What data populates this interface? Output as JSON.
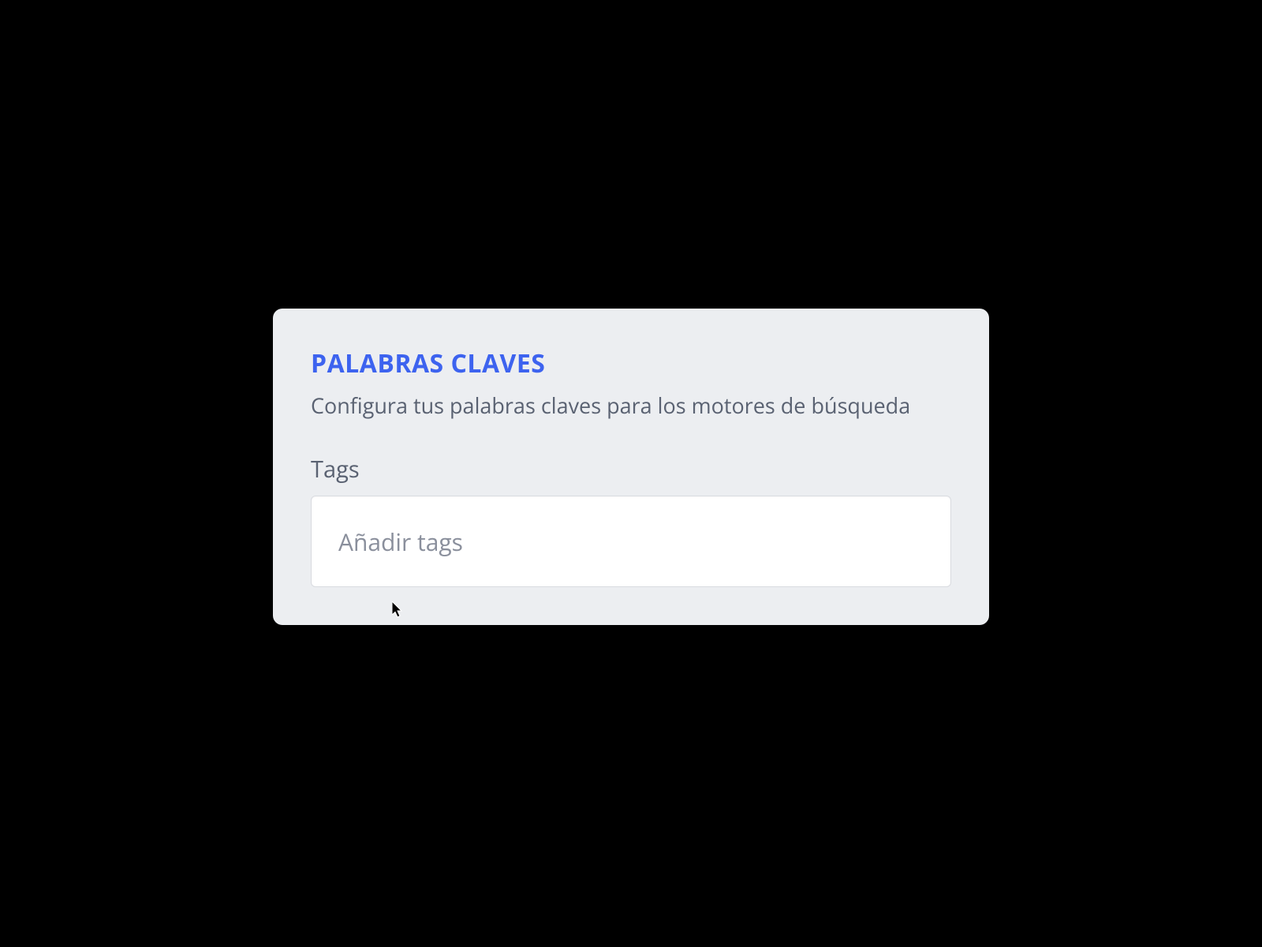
{
  "card": {
    "title": "PALABRAS CLAVES",
    "subtitle": "Configura tus palabras claves para los motores de búsqueda",
    "field_label": "Tags",
    "tags_placeholder": "Añadir tags",
    "tags_value": ""
  }
}
